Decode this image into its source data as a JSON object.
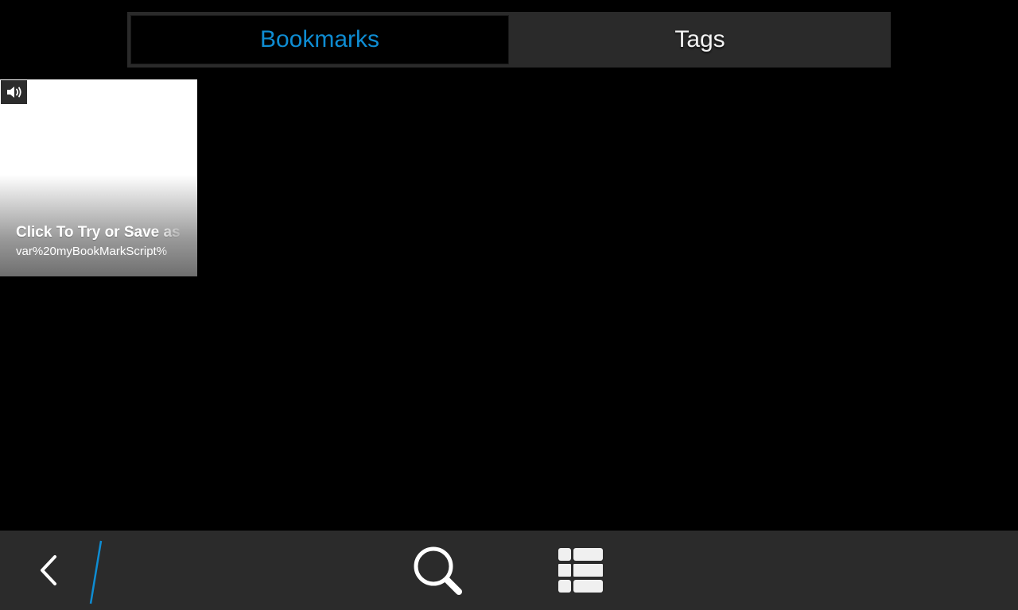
{
  "tabs": {
    "bookmarks_label": "Bookmarks",
    "tags_label": "Tags",
    "active": "Bookmarks"
  },
  "bookmarks": [
    {
      "title": "Click To Try or Save as",
      "url": "var%20myBookMarkScript%",
      "badge_icon": "speaker-icon"
    }
  ],
  "actionbar": {
    "back_icon": "chevron-left-icon",
    "search_icon": "search-icon",
    "list_icon": "list-view-icon"
  },
  "colors": {
    "accent": "#0e8cd2",
    "background": "#000000",
    "bar": "#2b2b2b"
  }
}
